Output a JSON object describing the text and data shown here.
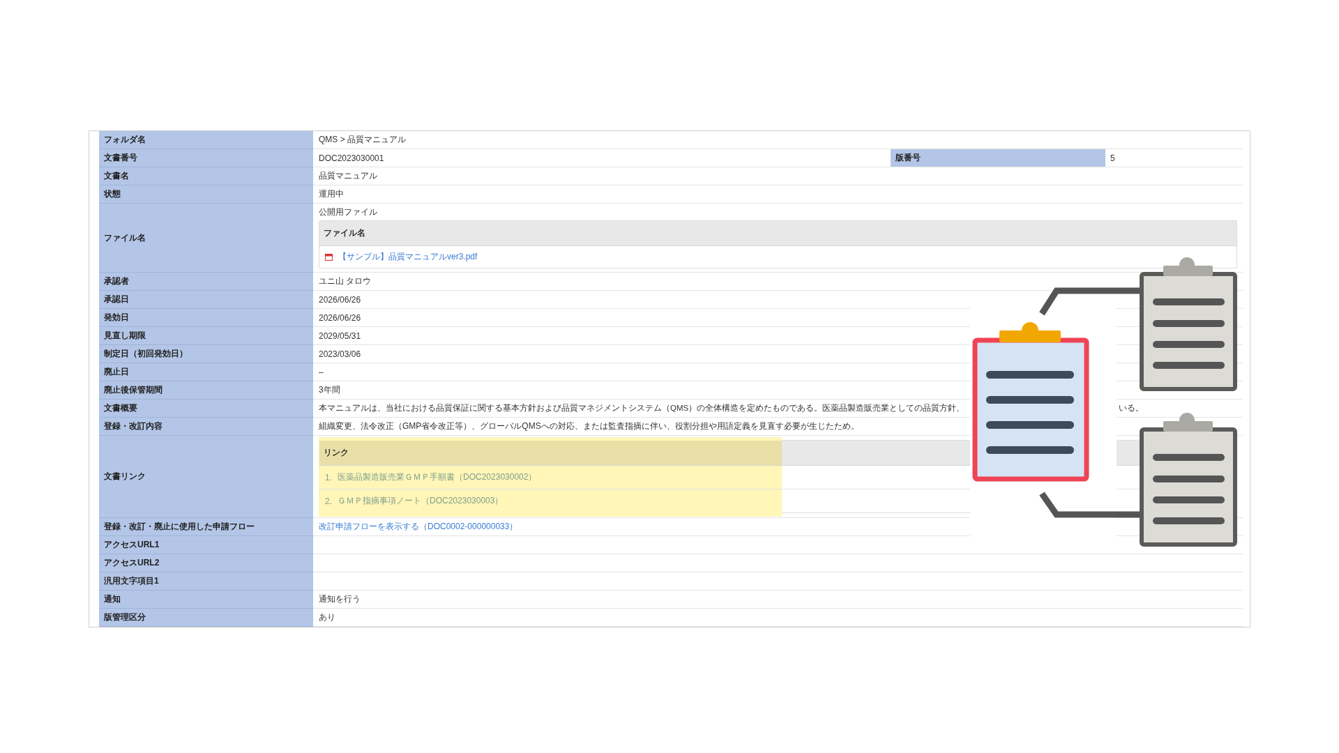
{
  "rows": [
    {
      "kind": "text",
      "label": "フォルダ名",
      "value": "QMS > 品質マニュアル"
    },
    {
      "kind": "pair",
      "label": "文書番号",
      "value": "DOC2023030001",
      "label2": "版番号",
      "value2": "5"
    },
    {
      "kind": "text",
      "label": "文書名",
      "value": "品質マニュアル"
    },
    {
      "kind": "text",
      "label": "状態",
      "value": "運用中"
    },
    {
      "kind": "files",
      "label": "ファイル名",
      "caption": "公開用ファイル",
      "header": "ファイル名",
      "files": [
        "【サンプル】品質マニュアルver3.pdf"
      ]
    },
    {
      "kind": "text",
      "label": "承認者",
      "value": "ユニ山 タロウ"
    },
    {
      "kind": "text",
      "label": "承認日",
      "value": "2026/06/26"
    },
    {
      "kind": "text",
      "label": "発効日",
      "value": "2026/06/26"
    },
    {
      "kind": "text",
      "label": "見直し期限",
      "value": "2029/05/31"
    },
    {
      "kind": "text",
      "label": "制定日（初回発効日）",
      "value": "2023/03/06"
    },
    {
      "kind": "text",
      "label": "廃止日",
      "value": "–"
    },
    {
      "kind": "text",
      "label": "廃止後保管期間",
      "value": "3年間"
    },
    {
      "kind": "split",
      "label": "文書概要",
      "value": "本マニュアルは、当社における品質保証に関する基本方針および品質マネジメントシステム（QMS）の全体構造を定めたものである。医薬品製造販売業としての品質方針、",
      "value_after": "いる。"
    },
    {
      "kind": "text",
      "label": "登録・改訂内容",
      "value": "組織変更、法令改正（GMP省令改正等）、グローバルQMSへの対応、または監査指摘に伴い、役割分担や用語定義を見直す必要が生じたため。"
    },
    {
      "kind": "links",
      "label": "文書リンク",
      "header": "リンク",
      "highlighted": true,
      "links": [
        {
          "number": "1.",
          "text": "医薬品製造販売業ＧＭＰ手順書（DOC2023030002）"
        },
        {
          "number": "2.",
          "text": "ＧＭＰ指摘事項ノート（DOC2023030003）"
        }
      ]
    },
    {
      "kind": "link",
      "label": "登録・改訂・廃止に使用した申請フロー",
      "value": "改訂申請フローを表示する（DOC0002-000000033）"
    },
    {
      "kind": "text",
      "label": "アクセスURL1"
    },
    {
      "kind": "text",
      "label": "アクセスURL2"
    },
    {
      "kind": "text",
      "label": "汎用文字項目1"
    },
    {
      "kind": "text",
      "label": "通知",
      "value": "通知を行う"
    },
    {
      "kind": "text",
      "label": "版管理区分",
      "value": "あり"
    }
  ],
  "overlay": {
    "kind": "clipboards"
  }
}
